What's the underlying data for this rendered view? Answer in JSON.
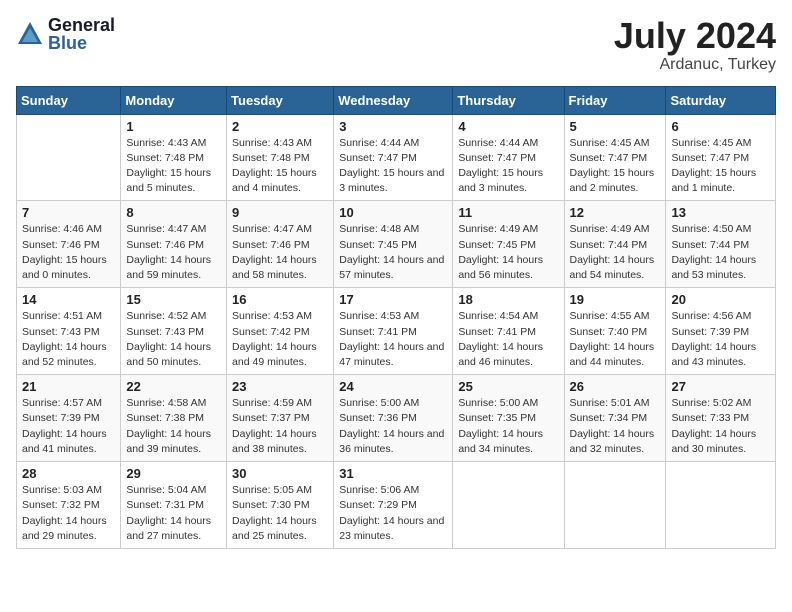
{
  "logo": {
    "general": "General",
    "blue": "Blue"
  },
  "title": {
    "month_year": "July 2024",
    "location": "Ardanuc, Turkey"
  },
  "days_of_week": [
    "Sunday",
    "Monday",
    "Tuesday",
    "Wednesday",
    "Thursday",
    "Friday",
    "Saturday"
  ],
  "weeks": [
    [
      null,
      {
        "day": 1,
        "sunrise": "4:43 AM",
        "sunset": "7:48 PM",
        "daylight": "15 hours and 5 minutes."
      },
      {
        "day": 2,
        "sunrise": "4:43 AM",
        "sunset": "7:48 PM",
        "daylight": "15 hours and 4 minutes."
      },
      {
        "day": 3,
        "sunrise": "4:44 AM",
        "sunset": "7:47 PM",
        "daylight": "15 hours and 3 minutes."
      },
      {
        "day": 4,
        "sunrise": "4:44 AM",
        "sunset": "7:47 PM",
        "daylight": "15 hours and 3 minutes."
      },
      {
        "day": 5,
        "sunrise": "4:45 AM",
        "sunset": "7:47 PM",
        "daylight": "15 hours and 2 minutes."
      },
      {
        "day": 6,
        "sunrise": "4:45 AM",
        "sunset": "7:47 PM",
        "daylight": "15 hours and 1 minute."
      }
    ],
    [
      {
        "day": 7,
        "sunrise": "4:46 AM",
        "sunset": "7:46 PM",
        "daylight": "15 hours and 0 minutes."
      },
      {
        "day": 8,
        "sunrise": "4:47 AM",
        "sunset": "7:46 PM",
        "daylight": "14 hours and 59 minutes."
      },
      {
        "day": 9,
        "sunrise": "4:47 AM",
        "sunset": "7:46 PM",
        "daylight": "14 hours and 58 minutes."
      },
      {
        "day": 10,
        "sunrise": "4:48 AM",
        "sunset": "7:45 PM",
        "daylight": "14 hours and 57 minutes."
      },
      {
        "day": 11,
        "sunrise": "4:49 AM",
        "sunset": "7:45 PM",
        "daylight": "14 hours and 56 minutes."
      },
      {
        "day": 12,
        "sunrise": "4:49 AM",
        "sunset": "7:44 PM",
        "daylight": "14 hours and 54 minutes."
      },
      {
        "day": 13,
        "sunrise": "4:50 AM",
        "sunset": "7:44 PM",
        "daylight": "14 hours and 53 minutes."
      }
    ],
    [
      {
        "day": 14,
        "sunrise": "4:51 AM",
        "sunset": "7:43 PM",
        "daylight": "14 hours and 52 minutes."
      },
      {
        "day": 15,
        "sunrise": "4:52 AM",
        "sunset": "7:43 PM",
        "daylight": "14 hours and 50 minutes."
      },
      {
        "day": 16,
        "sunrise": "4:53 AM",
        "sunset": "7:42 PM",
        "daylight": "14 hours and 49 minutes."
      },
      {
        "day": 17,
        "sunrise": "4:53 AM",
        "sunset": "7:41 PM",
        "daylight": "14 hours and 47 minutes."
      },
      {
        "day": 18,
        "sunrise": "4:54 AM",
        "sunset": "7:41 PM",
        "daylight": "14 hours and 46 minutes."
      },
      {
        "day": 19,
        "sunrise": "4:55 AM",
        "sunset": "7:40 PM",
        "daylight": "14 hours and 44 minutes."
      },
      {
        "day": 20,
        "sunrise": "4:56 AM",
        "sunset": "7:39 PM",
        "daylight": "14 hours and 43 minutes."
      }
    ],
    [
      {
        "day": 21,
        "sunrise": "4:57 AM",
        "sunset": "7:39 PM",
        "daylight": "14 hours and 41 minutes."
      },
      {
        "day": 22,
        "sunrise": "4:58 AM",
        "sunset": "7:38 PM",
        "daylight": "14 hours and 39 minutes."
      },
      {
        "day": 23,
        "sunrise": "4:59 AM",
        "sunset": "7:37 PM",
        "daylight": "14 hours and 38 minutes."
      },
      {
        "day": 24,
        "sunrise": "5:00 AM",
        "sunset": "7:36 PM",
        "daylight": "14 hours and 36 minutes."
      },
      {
        "day": 25,
        "sunrise": "5:00 AM",
        "sunset": "7:35 PM",
        "daylight": "14 hours and 34 minutes."
      },
      {
        "day": 26,
        "sunrise": "5:01 AM",
        "sunset": "7:34 PM",
        "daylight": "14 hours and 32 minutes."
      },
      {
        "day": 27,
        "sunrise": "5:02 AM",
        "sunset": "7:33 PM",
        "daylight": "14 hours and 30 minutes."
      }
    ],
    [
      {
        "day": 28,
        "sunrise": "5:03 AM",
        "sunset": "7:32 PM",
        "daylight": "14 hours and 29 minutes."
      },
      {
        "day": 29,
        "sunrise": "5:04 AM",
        "sunset": "7:31 PM",
        "daylight": "14 hours and 27 minutes."
      },
      {
        "day": 30,
        "sunrise": "5:05 AM",
        "sunset": "7:30 PM",
        "daylight": "14 hours and 25 minutes."
      },
      {
        "day": 31,
        "sunrise": "5:06 AM",
        "sunset": "7:29 PM",
        "daylight": "14 hours and 23 minutes."
      },
      null,
      null,
      null
    ]
  ]
}
